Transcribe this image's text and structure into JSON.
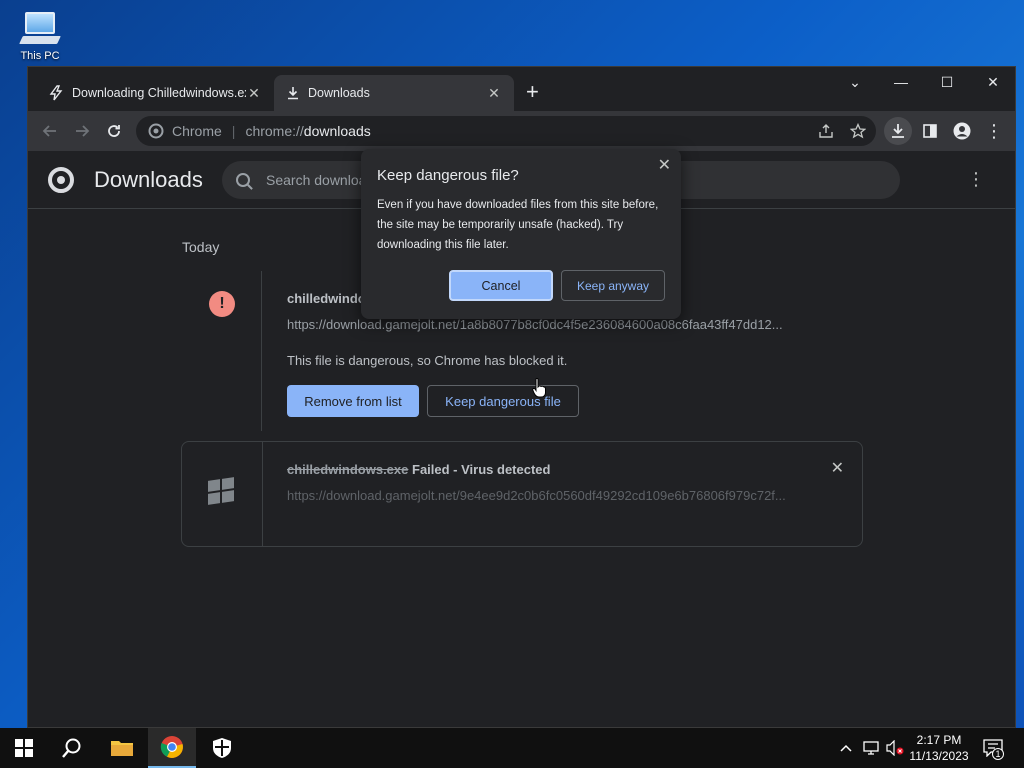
{
  "desktop": {
    "icon_label": "This PC"
  },
  "browser": {
    "tabs": [
      {
        "title": "Downloading Chilledwindows.exe",
        "close": "✕"
      },
      {
        "title": "Downloads",
        "close": "✕"
      }
    ],
    "new_tab": "+",
    "window_controls": {
      "tab_search": "⌄",
      "minimize": "—",
      "maximize": "☐",
      "close": "✕"
    },
    "omnibox": {
      "site_label": "Chrome",
      "scheme": "chrome://",
      "path": "downloads"
    }
  },
  "downloads_page": {
    "title": "Downloads",
    "search_placeholder": "Search downloads",
    "menu": "⋮",
    "date_header": "Today",
    "items": [
      {
        "file_name": "chilledwindows.exe",
        "url": "https://download.gamejolt.net/1a8b8077b8cf0dc4f5e236084600a08c6faa43ff47dd12...",
        "message": "This file is dangerous, so Chrome has blocked it.",
        "remove_label": "Remove from list",
        "keep_label": "Keep dangerous file",
        "icon": "!"
      },
      {
        "file_name": "chilledwindows.exe",
        "status": "Failed - Virus detected",
        "url": "https://download.gamejolt.net/9e4ee9d2c0b6fc0560df49292cd109e6b76806f979c72f...",
        "close": "✕"
      }
    ]
  },
  "dialog": {
    "title": "Keep dangerous file?",
    "body": "Even if you have downloaded files from this site before, the site may be temporarily unsafe (hacked). Try downloading this file later.",
    "cancel_label": "Cancel",
    "keep_label": "Keep anyway",
    "close": "✕"
  },
  "taskbar": {
    "time": "2:17 PM",
    "date": "11/13/2023",
    "notification_count": "1"
  },
  "colors": {
    "accent": "#8ab4f8",
    "danger": "#f28b82",
    "page_bg": "#202124",
    "toolbar_bg": "#35363a"
  }
}
